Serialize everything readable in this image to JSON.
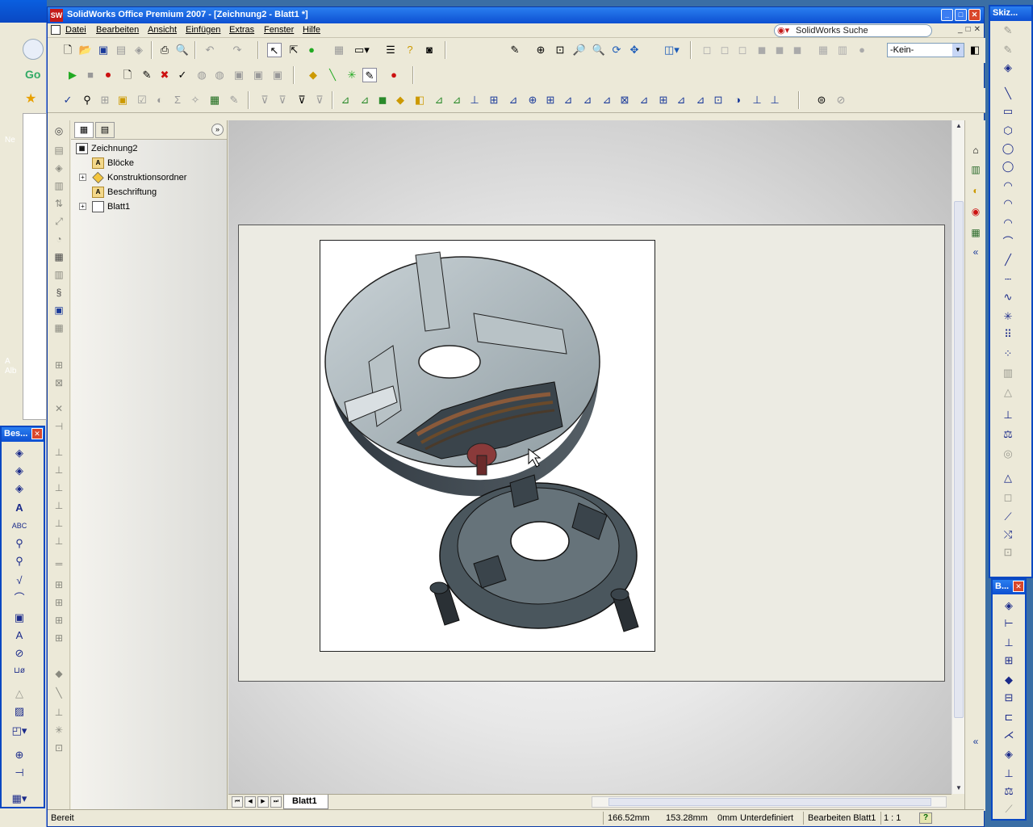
{
  "app": {
    "title": "SolidWorks Office Premium 2007 - [Zeichnung2 - Blatt1 *]",
    "logo": "SW",
    "window_buttons": [
      "_",
      "□",
      "✕"
    ]
  },
  "background": {
    "left_labels": [
      "Ne",
      "A",
      "Alb"
    ]
  },
  "menu": {
    "items": [
      "Datei",
      "Bearbeiten",
      "Ansicht",
      "Einfügen",
      "Extras",
      "Fenster",
      "Hilfe"
    ],
    "search_label": "SolidWorks Suche",
    "mdi_buttons": [
      "_",
      "□",
      "✕"
    ]
  },
  "toolbar": {
    "layer_combo": "-Kein-"
  },
  "feature_tree": {
    "root": "Zeichnung2",
    "items": [
      {
        "label": "Blöcke",
        "icon": "blocks-icon"
      },
      {
        "label": "Konstruktionsordner",
        "icon": "design-folder-icon"
      },
      {
        "label": "Beschriftung",
        "icon": "annotation-icon"
      },
      {
        "label": "Blatt1",
        "icon": "sheet-icon"
      }
    ]
  },
  "sheet_tabs": {
    "active": "Blatt1"
  },
  "status": {
    "state": "Bereit",
    "x": "166.52mm",
    "y": "153.28mm",
    "z": "0mm",
    "definition": "Unterdefiniert",
    "edit": "Bearbeiten Blatt1",
    "scale": "1 : 1",
    "help": "?"
  },
  "palettes": {
    "left_title": "Bes...",
    "right_top_title": "Skiz...",
    "right_bottom_title": "B..."
  },
  "colors": {
    "title_blue": "#0d4fd1",
    "window_bg": "#ece9d8",
    "close_red": "#d9472b"
  }
}
